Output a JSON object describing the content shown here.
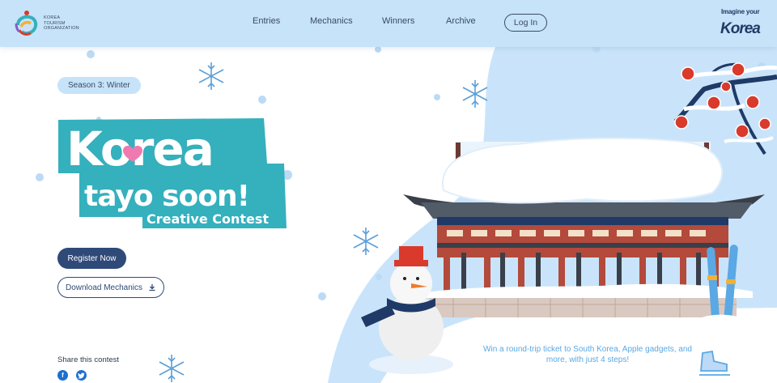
{
  "header": {
    "org_name_lines": [
      "KOREA",
      "TOURISM",
      "ORGANIZATION"
    ],
    "nav": [
      {
        "label": "Entries"
      },
      {
        "label": "Mechanics"
      },
      {
        "label": "Winners"
      },
      {
        "label": "Archive"
      }
    ],
    "login_label": "Log In",
    "brand": {
      "top": "Imagine your",
      "main": "Korea"
    }
  },
  "hero": {
    "season_badge": "Season 3: Winter",
    "title_line1": "Korea",
    "title_line2": "tayo soon!",
    "title_line3": "Creative Contest",
    "register_label": "Register Now",
    "download_label": "Download Mechanics",
    "share_label": "Share this contest",
    "social": [
      {
        "name": "facebook-icon"
      },
      {
        "name": "twitter-icon"
      }
    ],
    "promo_text": "Win a round-trip ticket to South Korea, Apple gadgets, and more, with just 4 steps!"
  },
  "colors": {
    "header_bg": "#c6e3f9",
    "navy": "#2f4a78",
    "teal": "#35b0bd",
    "snow_blue": "#c9e4fa",
    "accent_red": "#d93a2b",
    "promo_text": "#5aa8e4"
  }
}
